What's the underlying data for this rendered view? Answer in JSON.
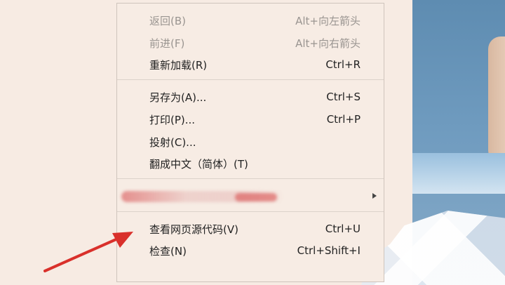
{
  "context_menu": {
    "items": [
      {
        "label": "返回(B)",
        "shortcut": "Alt+向左箭头",
        "disabled": true
      },
      {
        "label": "前进(F)",
        "shortcut": "Alt+向右箭头",
        "disabled": true
      },
      {
        "label": "重新加载(R)",
        "shortcut": "Ctrl+R",
        "disabled": false
      },
      {
        "label": "另存为(A)...",
        "shortcut": "Ctrl+S",
        "disabled": false
      },
      {
        "label": "打印(P)...",
        "shortcut": "Ctrl+P",
        "disabled": false
      },
      {
        "label": "投射(C)...",
        "shortcut": "",
        "disabled": false
      },
      {
        "label": "翻成中文（简体）(T)",
        "shortcut": "",
        "disabled": false
      },
      {
        "label": "查看网页源代码(V)",
        "shortcut": "Ctrl+U",
        "disabled": false
      },
      {
        "label": "检查(N)",
        "shortcut": "Ctrl+Shift+I",
        "disabled": false
      }
    ]
  },
  "colors": {
    "page_background": "#f7ebe3",
    "menu_background": "#f7ece4",
    "disabled_text": "#9a9591",
    "annotation_arrow": "#d9302b"
  },
  "icons": [
    "submenu-arrow-icon",
    "annotation-arrow"
  ]
}
